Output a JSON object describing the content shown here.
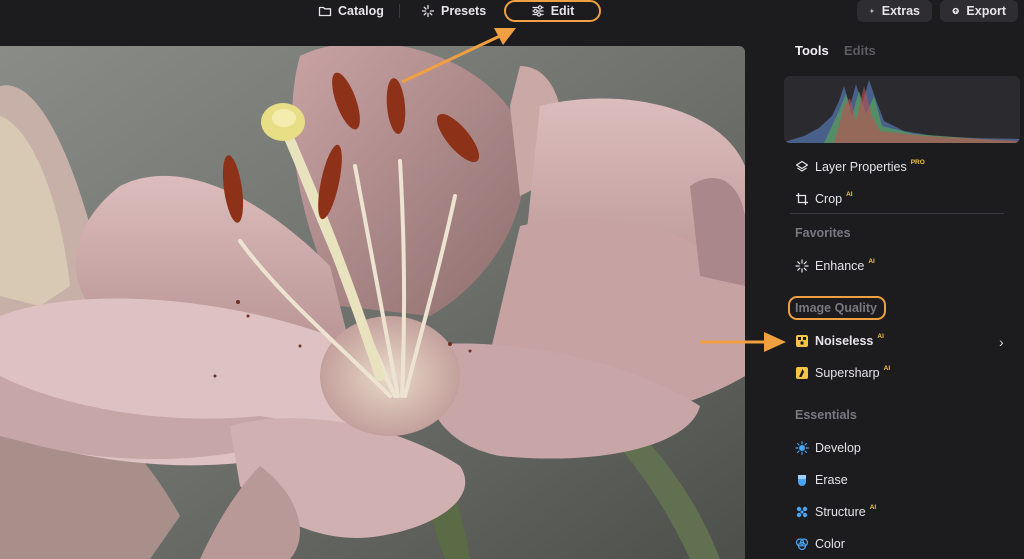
{
  "topbar": {
    "catalog_label": "Catalog",
    "presets_label": "Presets",
    "edit_label": "Edit",
    "extras_label": "Extras",
    "export_label": "Export"
  },
  "panel": {
    "tab_tools": "Tools",
    "tab_edits": "Edits",
    "layer_properties": "Layer Properties",
    "layer_properties_badge": "PRO",
    "crop": "Crop",
    "crop_badge": "AI",
    "favorites_heading": "Favorites",
    "enhance": "Enhance",
    "enhance_badge": "AI",
    "image_quality_heading": "Image Quality",
    "noiseless": "Noiseless",
    "noiseless_badge": "AI",
    "supersharp": "Supersharp",
    "supersharp_badge": "AI",
    "essentials_heading": "Essentials",
    "develop": "Develop",
    "erase": "Erase",
    "structure": "Structure",
    "structure_badge": "AI",
    "color": "Color"
  },
  "colors": {
    "annotation": "#f0a040",
    "badge": "#f5c443",
    "panel_bg": "#1c1b1d"
  },
  "icons": [
    "folder-icon",
    "sparkle-icon",
    "sliders-icon",
    "star-icon",
    "export-icon",
    "layers-icon",
    "crop-icon",
    "enhance-icon",
    "noiseless-icon",
    "supersharp-icon",
    "develop-icon",
    "erase-icon",
    "structure-icon",
    "color-icon",
    "chevron-right-icon"
  ]
}
